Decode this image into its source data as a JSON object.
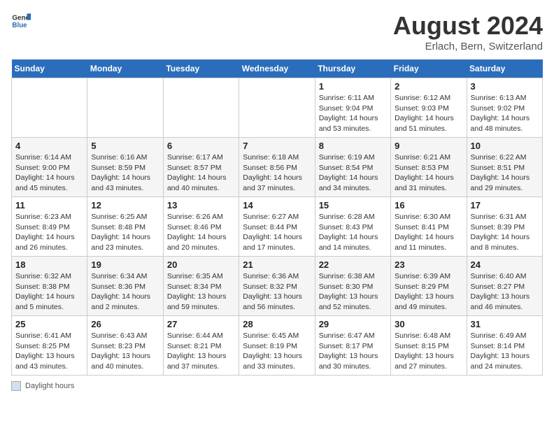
{
  "header": {
    "logo_general": "General",
    "logo_blue": "Blue",
    "main_title": "August 2024",
    "subtitle": "Erlach, Bern, Switzerland"
  },
  "legend": {
    "box_label": "Daylight hours"
  },
  "days_of_week": [
    "Sunday",
    "Monday",
    "Tuesday",
    "Wednesday",
    "Thursday",
    "Friday",
    "Saturday"
  ],
  "weeks": [
    {
      "days": [
        {
          "num": "",
          "info": ""
        },
        {
          "num": "",
          "info": ""
        },
        {
          "num": "",
          "info": ""
        },
        {
          "num": "",
          "info": ""
        },
        {
          "num": "1",
          "info": "Sunrise: 6:11 AM\nSunset: 9:04 PM\nDaylight: 14 hours and 53 minutes."
        },
        {
          "num": "2",
          "info": "Sunrise: 6:12 AM\nSunset: 9:03 PM\nDaylight: 14 hours and 51 minutes."
        },
        {
          "num": "3",
          "info": "Sunrise: 6:13 AM\nSunset: 9:02 PM\nDaylight: 14 hours and 48 minutes."
        }
      ]
    },
    {
      "days": [
        {
          "num": "4",
          "info": "Sunrise: 6:14 AM\nSunset: 9:00 PM\nDaylight: 14 hours and 45 minutes."
        },
        {
          "num": "5",
          "info": "Sunrise: 6:16 AM\nSunset: 8:59 PM\nDaylight: 14 hours and 43 minutes."
        },
        {
          "num": "6",
          "info": "Sunrise: 6:17 AM\nSunset: 8:57 PM\nDaylight: 14 hours and 40 minutes."
        },
        {
          "num": "7",
          "info": "Sunrise: 6:18 AM\nSunset: 8:56 PM\nDaylight: 14 hours and 37 minutes."
        },
        {
          "num": "8",
          "info": "Sunrise: 6:19 AM\nSunset: 8:54 PM\nDaylight: 14 hours and 34 minutes."
        },
        {
          "num": "9",
          "info": "Sunrise: 6:21 AM\nSunset: 8:53 PM\nDaylight: 14 hours and 31 minutes."
        },
        {
          "num": "10",
          "info": "Sunrise: 6:22 AM\nSunset: 8:51 PM\nDaylight: 14 hours and 29 minutes."
        }
      ]
    },
    {
      "days": [
        {
          "num": "11",
          "info": "Sunrise: 6:23 AM\nSunset: 8:49 PM\nDaylight: 14 hours and 26 minutes."
        },
        {
          "num": "12",
          "info": "Sunrise: 6:25 AM\nSunset: 8:48 PM\nDaylight: 14 hours and 23 minutes."
        },
        {
          "num": "13",
          "info": "Sunrise: 6:26 AM\nSunset: 8:46 PM\nDaylight: 14 hours and 20 minutes."
        },
        {
          "num": "14",
          "info": "Sunrise: 6:27 AM\nSunset: 8:44 PM\nDaylight: 14 hours and 17 minutes."
        },
        {
          "num": "15",
          "info": "Sunrise: 6:28 AM\nSunset: 8:43 PM\nDaylight: 14 hours and 14 minutes."
        },
        {
          "num": "16",
          "info": "Sunrise: 6:30 AM\nSunset: 8:41 PM\nDaylight: 14 hours and 11 minutes."
        },
        {
          "num": "17",
          "info": "Sunrise: 6:31 AM\nSunset: 8:39 PM\nDaylight: 14 hours and 8 minutes."
        }
      ]
    },
    {
      "days": [
        {
          "num": "18",
          "info": "Sunrise: 6:32 AM\nSunset: 8:38 PM\nDaylight: 14 hours and 5 minutes."
        },
        {
          "num": "19",
          "info": "Sunrise: 6:34 AM\nSunset: 8:36 PM\nDaylight: 14 hours and 2 minutes."
        },
        {
          "num": "20",
          "info": "Sunrise: 6:35 AM\nSunset: 8:34 PM\nDaylight: 13 hours and 59 minutes."
        },
        {
          "num": "21",
          "info": "Sunrise: 6:36 AM\nSunset: 8:32 PM\nDaylight: 13 hours and 56 minutes."
        },
        {
          "num": "22",
          "info": "Sunrise: 6:38 AM\nSunset: 8:30 PM\nDaylight: 13 hours and 52 minutes."
        },
        {
          "num": "23",
          "info": "Sunrise: 6:39 AM\nSunset: 8:29 PM\nDaylight: 13 hours and 49 minutes."
        },
        {
          "num": "24",
          "info": "Sunrise: 6:40 AM\nSunset: 8:27 PM\nDaylight: 13 hours and 46 minutes."
        }
      ]
    },
    {
      "days": [
        {
          "num": "25",
          "info": "Sunrise: 6:41 AM\nSunset: 8:25 PM\nDaylight: 13 hours and 43 minutes."
        },
        {
          "num": "26",
          "info": "Sunrise: 6:43 AM\nSunset: 8:23 PM\nDaylight: 13 hours and 40 minutes."
        },
        {
          "num": "27",
          "info": "Sunrise: 6:44 AM\nSunset: 8:21 PM\nDaylight: 13 hours and 37 minutes."
        },
        {
          "num": "28",
          "info": "Sunrise: 6:45 AM\nSunset: 8:19 PM\nDaylight: 13 hours and 33 minutes."
        },
        {
          "num": "29",
          "info": "Sunrise: 6:47 AM\nSunset: 8:17 PM\nDaylight: 13 hours and 30 minutes."
        },
        {
          "num": "30",
          "info": "Sunrise: 6:48 AM\nSunset: 8:15 PM\nDaylight: 13 hours and 27 minutes."
        },
        {
          "num": "31",
          "info": "Sunrise: 6:49 AM\nSunset: 8:14 PM\nDaylight: 13 hours and 24 minutes."
        }
      ]
    }
  ]
}
